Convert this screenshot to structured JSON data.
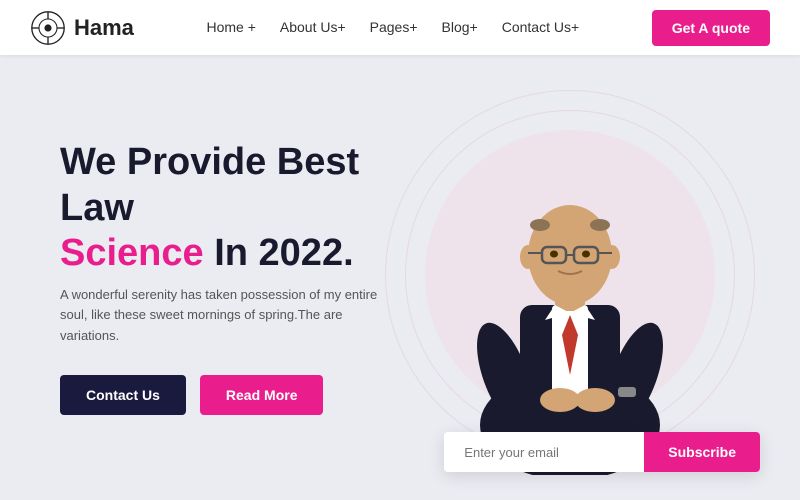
{
  "navbar": {
    "logo_text": "Hama",
    "nav_items": [
      {
        "label": "Home +",
        "id": "home"
      },
      {
        "label": "About Us+",
        "id": "about"
      },
      {
        "label": "Pages+",
        "id": "pages"
      },
      {
        "label": "Blog+",
        "id": "blog"
      },
      {
        "label": "Contact Us+",
        "id": "contact"
      }
    ],
    "cta_label": "Get A quote"
  },
  "hero": {
    "title_line1": "We Provide Best Law",
    "title_accent": "Science",
    "title_line2": " In 2022.",
    "description": "A wonderful serenity has taken possession of my entire soul, like these sweet mornings of spring.The are variations.",
    "btn_contact": "Contact Us",
    "btn_readmore": "Read More"
  },
  "subscribe": {
    "placeholder": "Enter your email",
    "btn_label": "Subscribe"
  },
  "colors": {
    "accent": "#e91e8c",
    "dark": "#1a1a3e"
  }
}
